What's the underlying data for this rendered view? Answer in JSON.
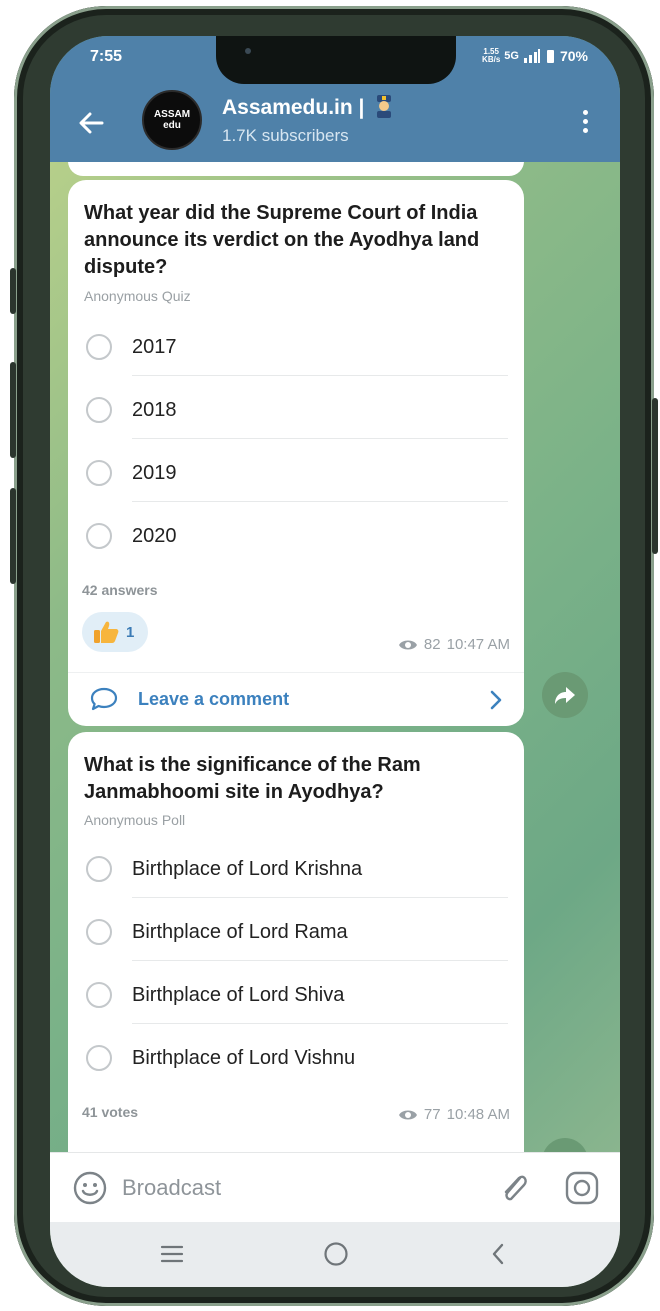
{
  "status_bar": {
    "time": "7:55",
    "speed_value": "1.55",
    "speed_unit": "KB/s",
    "network": "5G",
    "battery": "70%"
  },
  "header": {
    "channel_name": "Assamedu.in |",
    "subscribers": "1.7K subscribers",
    "avatar_text": "ASSAM",
    "avatar_text2": "edu"
  },
  "messages": [
    {
      "question": "What year did the Supreme Court of India announce its verdict on the Ayodhya land dispute?",
      "type": "Anonymous Quiz",
      "options": [
        "2017",
        "2018",
        "2019",
        "2020"
      ],
      "answers": "42 answers",
      "reaction_count": "1",
      "views": "82",
      "time": "10:47 AM",
      "comment_label": "Leave a comment"
    },
    {
      "question": "What is the significance of the Ram Janmabhoomi site in Ayodhya?",
      "type": "Anonymous Poll",
      "options": [
        "Birthplace of Lord Krishna",
        "Birthplace of Lord Rama",
        "Birthplace of Lord Shiva",
        "Birthplace of Lord Vishnu"
      ],
      "answers": "41 votes",
      "views": "77",
      "time": "10:48 AM"
    }
  ],
  "input": {
    "placeholder": "Broadcast"
  },
  "colors": {
    "header": "#4f81a9",
    "accent_blue": "#3c81be",
    "chat_background": "#88b389"
  }
}
